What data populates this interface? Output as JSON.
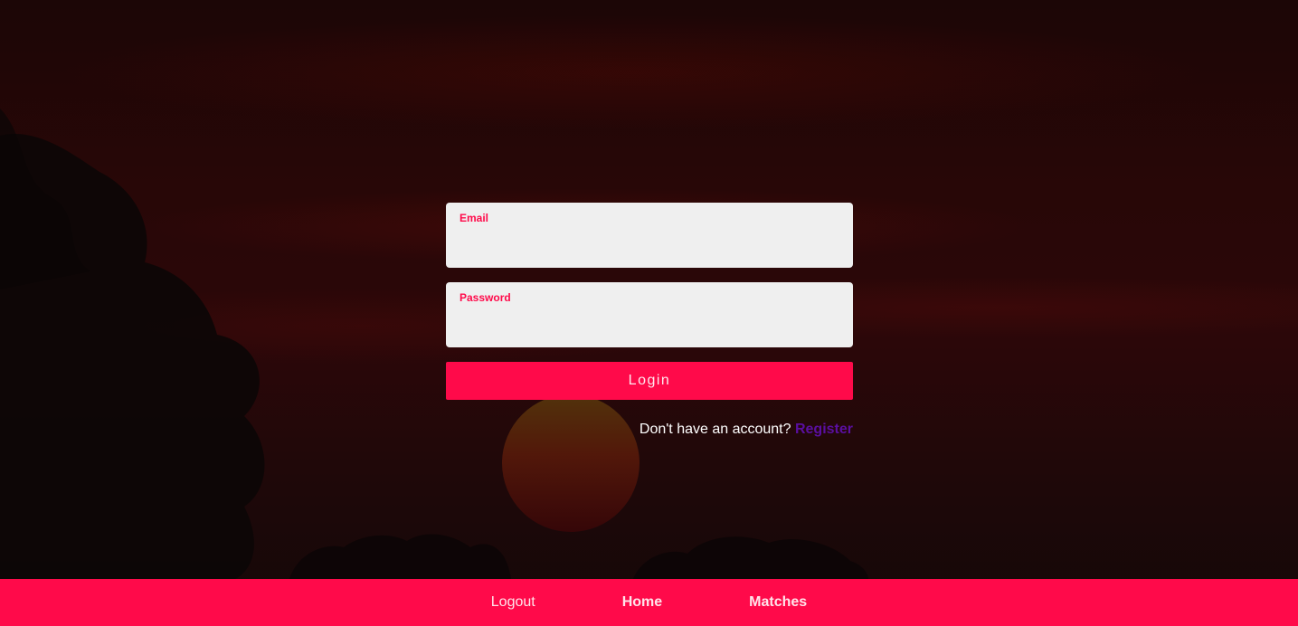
{
  "login_form": {
    "email_label": "Email",
    "email_value": "",
    "password_label": "Password",
    "password_value": "",
    "login_label": "Login",
    "register_prompt": "Don't have an account?",
    "register_link": "Register"
  },
  "navbar": {
    "items": [
      {
        "label": "Logout"
      },
      {
        "label": "Home"
      },
      {
        "label": "Matches"
      }
    ]
  },
  "colors": {
    "accent": "#ff0a4a",
    "field_background": "#efefef",
    "register_link": "#5a0fa0"
  }
}
